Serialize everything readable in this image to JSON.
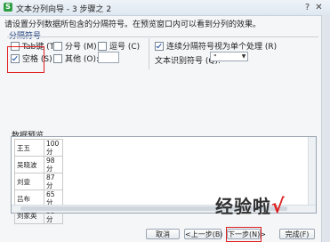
{
  "window": {
    "title": "文本分列向导 - 3 步骤之 2",
    "app_icon_glyph": "S"
  },
  "instruction": "请设置分列数据所包含的分隔符号。在预览窗口内可以看到分列的效果。",
  "delimiters": {
    "group_title": "分隔符号",
    "tab": {
      "label": "Tab键 (T)",
      "checked": false
    },
    "semicolon": {
      "label": "分号 (M)",
      "checked": false
    },
    "comma": {
      "label": "逗号 (C)",
      "checked": false
    },
    "space": {
      "label": "空格 (S)",
      "checked": true
    },
    "other": {
      "label": "其他 (O):",
      "checked": false,
      "value": ""
    }
  },
  "options": {
    "consecutive": {
      "label": "连续分隔符号视为单个处理 (R)",
      "checked": true
    },
    "text_qualifier_label": "文本识别符号 (Q):",
    "text_qualifier_value": "\""
  },
  "preview": {
    "label": "数据预览",
    "rows": [
      [
        "王五",
        "100分"
      ],
      [
        "吴晓波",
        "98分"
      ],
      [
        "刘壹",
        "87分"
      ],
      [
        "吕布",
        "65分"
      ],
      [
        "刘家英",
        "90分"
      ]
    ]
  },
  "buttons": {
    "cancel": "取消",
    "back": "<上一步(B)",
    "next": "下一步(N)>",
    "finish": "完成(F)"
  },
  "watermark": {
    "text": "经验啦",
    "mark": "√"
  },
  "colors": {
    "highlight": "#e02020",
    "checkmark": "#1b4ea3"
  }
}
